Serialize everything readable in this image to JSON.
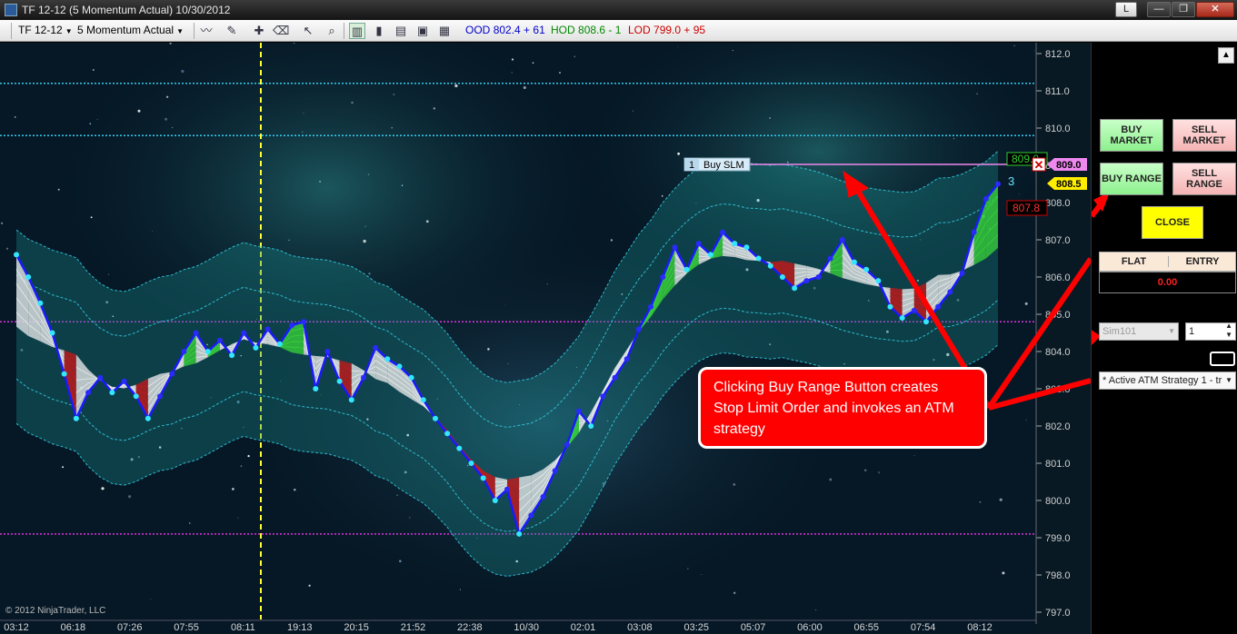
{
  "window": {
    "title": "TF 12-12 (5 Momentum Actual)  10/30/2012",
    "buttons": {
      "layout": "L",
      "minimize": "—",
      "maximize": "❐",
      "close": "✕"
    }
  },
  "toolbar": {
    "instrument": "TF 12-12",
    "period": "5 Momentum Actual",
    "ood_label": "OOD",
    "ood_value": "802.4 + 61",
    "hod_label": "HOD",
    "hod_value": "808.6 - 1",
    "lod_label": "LOD",
    "lod_value": "799.0 + 95",
    "colors": {
      "ood": "#0000cc",
      "hod": "#008800",
      "lod": "#cc0000"
    }
  },
  "chart": {
    "y_ticks": [
      "812.0",
      "811.0",
      "810.0",
      "809.0",
      "808.0",
      "807.0",
      "806.0",
      "805.0",
      "804.0",
      "803.0",
      "802.0",
      "801.0",
      "800.0",
      "799.0",
      "798.0",
      "797.0"
    ],
    "x_ticks": [
      "03:12",
      "06:18",
      "07:26",
      "07:55",
      "08:11",
      "19:13",
      "20:15",
      "21:52",
      "22:38",
      "10/30",
      "02:01",
      "03:08",
      "03:25",
      "05:07",
      "06:00",
      "06:55",
      "07:54",
      "08:12"
    ],
    "copyright": "© 2012 NinjaTrader, LLC",
    "order_label_qty": "1",
    "order_label_text": "Buy SLM",
    "price_flag_purple": "809.0",
    "price_flag_yellow": "808.5",
    "price_flag_green": "809.0",
    "price_flag_red": "807.8",
    "bar_counter": "3",
    "close_x": "✕",
    "price_range": [
      797.0,
      812.0
    ],
    "hlines": [
      {
        "price": 811.2,
        "color": "#33ccee"
      },
      {
        "price": 809.8,
        "color": "#33ccee"
      },
      {
        "price": 804.8,
        "color": "#dd33dd"
      },
      {
        "price": 799.1,
        "color": "#dd33dd"
      }
    ],
    "price_series": [
      806.6,
      806.0,
      805.3,
      804.5,
      803.4,
      802.2,
      802.9,
      803.3,
      802.9,
      803.2,
      802.8,
      802.2,
      802.8,
      803.4,
      804.0,
      804.5,
      804.0,
      804.3,
      803.9,
      804.5,
      804.1,
      804.6,
      804.2,
      804.7,
      804.8,
      803.0,
      804.0,
      803.2,
      802.7,
      803.3,
      804.1,
      803.8,
      803.6,
      803.3,
      802.7,
      802.2,
      801.8,
      801.4,
      801.0,
      800.6,
      800.0,
      800.3,
      799.1,
      799.6,
      800.1,
      800.8,
      801.5,
      802.4,
      802.0,
      802.8,
      803.3,
      803.8,
      804.6,
      805.2,
      806.0,
      806.8,
      806.2,
      806.9,
      806.6,
      807.2,
      806.9,
      806.8,
      806.5,
      806.3,
      806.0,
      805.7,
      805.9,
      806.0,
      806.5,
      807.0,
      806.4,
      806.2,
      805.9,
      805.2,
      804.9,
      805.1,
      804.8,
      805.2,
      805.6,
      806.1,
      807.2,
      808.1,
      808.5
    ],
    "line_colors": {
      "price": "#1a1aff",
      "dots": "#33e6ff",
      "band": "#33c8dd",
      "cross_vline": "#ffff33"
    }
  },
  "panel": {
    "buy_market": "BUY MARKET",
    "sell_market": "SELL MARKET",
    "buy_range": "BUY RANGE",
    "sell_range": "SELL RANGE",
    "close": "CLOSE",
    "position_header": "FLAT",
    "entry_header": "ENTRY",
    "pnl": "0.00",
    "account": "Sim101",
    "quantity": "1",
    "atm_strategy": "* Active ATM Strategy 1 - tr",
    "scroll_up": "▲"
  },
  "callout": {
    "text": "Clicking Buy Range Button creates Stop Limit Order and invokes an ATM strategy"
  }
}
